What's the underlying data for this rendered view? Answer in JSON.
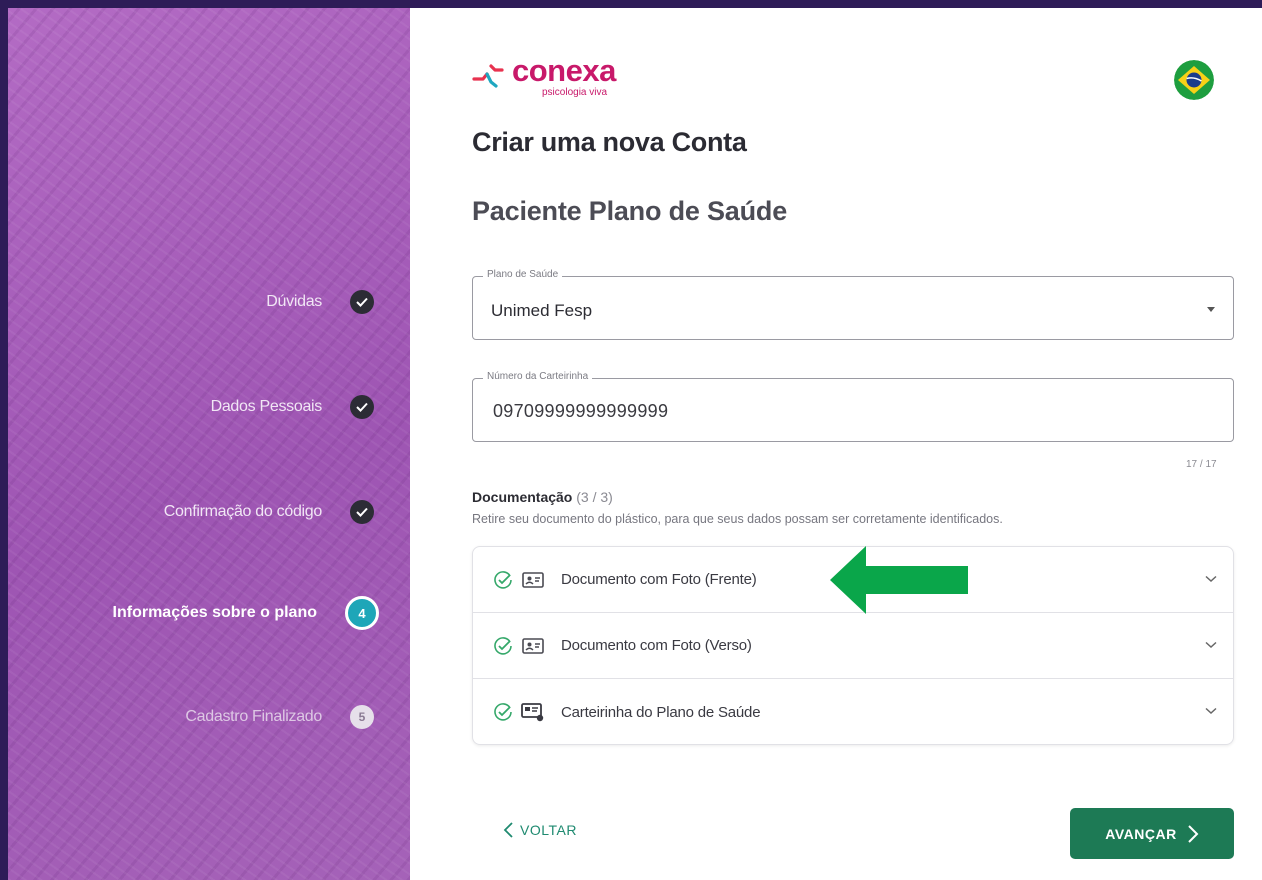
{
  "sidebar": {
    "steps": [
      {
        "label": "Dúvidas",
        "state": "done",
        "badge": ""
      },
      {
        "label": "Dados Pessoais",
        "state": "done",
        "badge": ""
      },
      {
        "label": "Confirmação do código",
        "state": "done",
        "badge": ""
      },
      {
        "label": "Informações sobre o plano",
        "state": "active",
        "badge": "4"
      },
      {
        "label": "Cadastro Finalizado",
        "state": "pending",
        "badge": "5"
      }
    ]
  },
  "brand": {
    "name": "conexa",
    "tagline": "psicologia viva",
    "color": "#c8196a",
    "language_flag": "brazil-flag-icon"
  },
  "page": {
    "title": "Criar uma nova Conta",
    "subtitle": "Paciente Plano de Saúde"
  },
  "form": {
    "plan": {
      "label": "Plano de Saúde",
      "value": "Unimed Fesp"
    },
    "card_number": {
      "label": "Número da Carteirinha",
      "value": "09709999999999999",
      "counter": "17 / 17"
    }
  },
  "documentation": {
    "heading": "Documentação",
    "count": "(3 / 3)",
    "hint": "Retire seu documento do plástico, para que seus dados possam ser corretamente identificados.",
    "items": [
      {
        "label": "Documento com Foto (Frente)",
        "status": "complete"
      },
      {
        "label": "Documento com Foto (Verso)",
        "status": "complete"
      },
      {
        "label": "Carteirinha do Plano de Saúde",
        "status": "complete"
      }
    ]
  },
  "actions": {
    "back": "VOLTAR",
    "next": "AVANÇAR"
  },
  "colors": {
    "primary_button": "#1d7a55",
    "step_active": "#1ea6b8",
    "annotation_arrow": "#0aa64a",
    "sidebar": "#a560b8"
  }
}
